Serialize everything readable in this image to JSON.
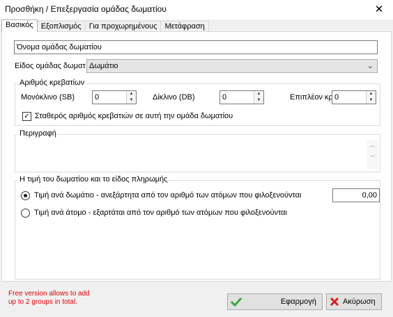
{
  "window": {
    "title": "Προσθήκη / Επεξεργασία ομάδας δωματίου",
    "close_icon": "✕"
  },
  "tabs": [
    {
      "label": "Βασικός",
      "active": true
    },
    {
      "label": "Εξοπλισμός"
    },
    {
      "label": "Για προχωρημένους"
    },
    {
      "label": "Μετάφραση"
    }
  ],
  "form": {
    "name_value": "Όνομα ομάδας δωματίου",
    "type_label": "Είδος ομάδας δωματ",
    "type_value": "Δωμάτιο",
    "beds": {
      "legend": "Αριθμός κρεβατίων",
      "single_label": "Μονόκλινο (SB)",
      "single_value": "0",
      "double_label": "Δίκλινο (DB)",
      "double_value": "0",
      "extra_label": "Επιπλέον κρε",
      "extra_value": "0",
      "fixed_label": "Σταθερός αριθμός κρεβατιών σε αυτή την ομάδα δωματίου",
      "fixed_checked": true
    },
    "description": {
      "legend": "Περιγραφή"
    },
    "pricing": {
      "legend": "Η τιμή του δωματίου και το είδος πληρωμής",
      "per_room_label": "Τιμή ανά δωμάτιο - ανεξάρτητα από τον αριθμό των ατόμων που φιλοξενούνται",
      "per_room_selected": true,
      "price_value": "0,00",
      "per_person_label": "Τιμή ανά άτομο - εξαρτάται από τον αριθμό των ατόμων που φιλοξενούνται",
      "per_person_selected": false
    }
  },
  "footer": {
    "note_line1": "Free version allows to add",
    "note_line2": "up to 2 groups in total.",
    "apply_label": "Εφαρμογή",
    "cancel_label": "Ακύρωση"
  },
  "colors": {
    "note": "#e00000",
    "apply_icon": "#3aa63a",
    "cancel_icon": "#d42020"
  }
}
